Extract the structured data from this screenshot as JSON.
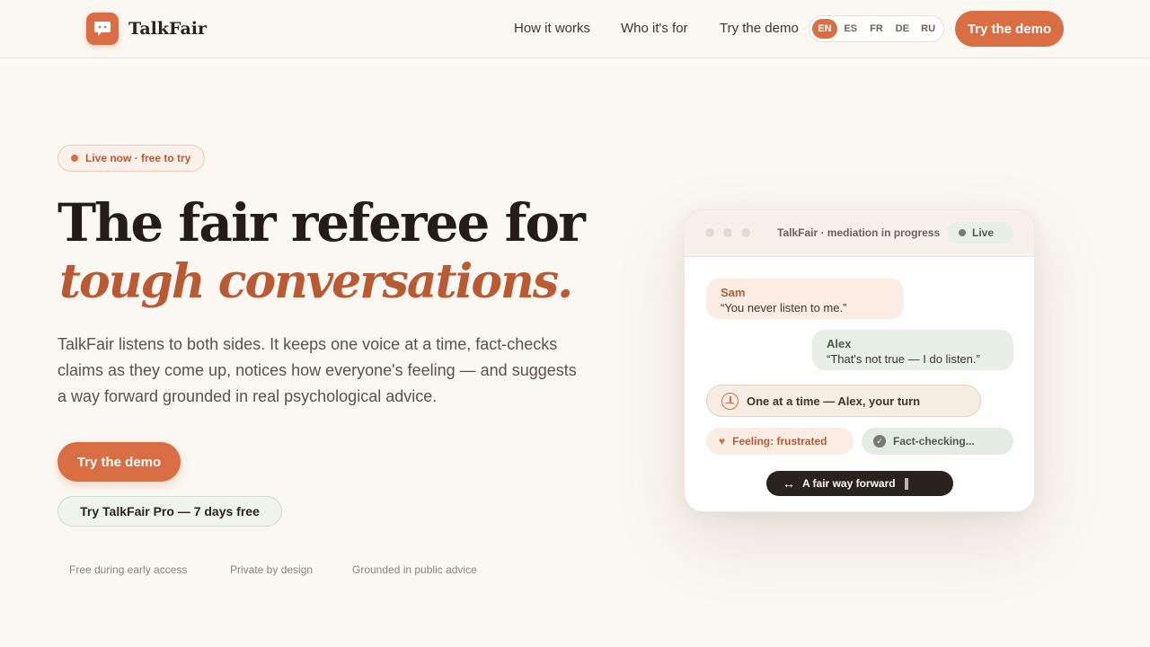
{
  "header": {
    "brand": "TalkFair",
    "nav": {
      "how": "How it works",
      "who": "Who it's for",
      "demo": "Try the demo"
    },
    "languages": [
      "EN",
      "ES",
      "FR",
      "DE",
      "RU"
    ],
    "active_language": "EN",
    "cta": "Try the demo"
  },
  "hero": {
    "badge": "Live now · free to try",
    "title_line1": "The fair referee for",
    "title_line2": "tough conversations.",
    "lede": "TalkFair listens to both sides. It keeps one voice at a time, fact-checks claims as they come up, notices how everyone's feeling — and suggests a way forward grounded in real psychological advice.",
    "cta_primary": "Try the demo",
    "cta_pro": "Try TalkFair Pro — 7 days free",
    "trust": [
      "Free during early access",
      "Private by design",
      "Grounded in public advice"
    ]
  },
  "mock": {
    "title": "TalkFair · mediation in progress",
    "live": "Live",
    "messages": [
      {
        "speaker": "Sam",
        "text": "“You never listen to me.”"
      },
      {
        "speaker": "Alex",
        "text": "“That's not true — I do listen.”"
      }
    ],
    "turn": "One at a time — Alex, your turn",
    "feeling": "Feeling: frustrated",
    "fact": "Fact-checking...",
    "forward": "A fair way forward"
  },
  "colors": {
    "accent": "#d96d43",
    "accent_dark": "#b85a34",
    "background": "#fbf7f2",
    "ink": "#2a221d"
  }
}
